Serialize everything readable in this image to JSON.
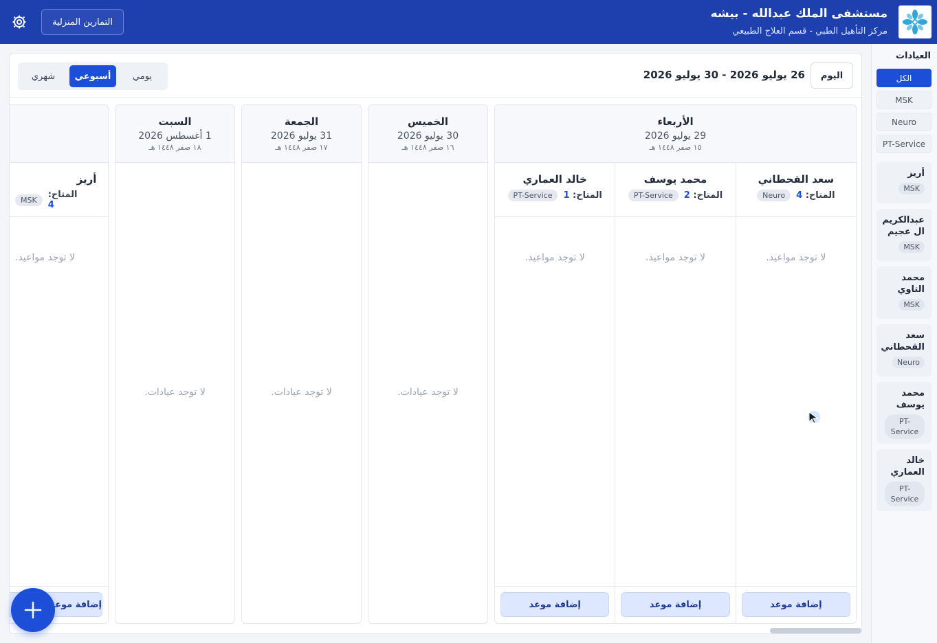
{
  "header": {
    "title": "مستشفى الملك عبدالله - بيشه",
    "subtitle": "مركز التأهيل الطبي - قسم العلاج الطبيعي",
    "home_exercises_label": "التمارين المنزلية",
    "settings_icon": "gear-icon",
    "logo_icon": "star-flower-logo"
  },
  "sidebar": {
    "title": "العيادات",
    "filters": [
      "الكل",
      "MSK",
      "Neuro",
      "PT-Service"
    ],
    "active_filter": "الكل",
    "clinics": [
      {
        "name": "أريز",
        "tag": "MSK"
      },
      {
        "name": "عبدالكريم ال عجيم",
        "tag": "MSK"
      },
      {
        "name": "محمد التاوي",
        "tag": "MSK"
      },
      {
        "name": "سعد القحطاني",
        "tag": "Neuro"
      },
      {
        "name": "محمد يوسف",
        "tag": "PT-Service"
      },
      {
        "name": "خالد العماري",
        "tag": "PT-Service"
      }
    ]
  },
  "toolbar": {
    "today_label": "اليوم",
    "date_range": "26 يوليو 2026 - 30 يوليو 2026",
    "views": [
      "يومي",
      "أسبوعي",
      "شهري"
    ],
    "active_view": "أسبوعي"
  },
  "days": [
    {
      "name": "الأربعاء",
      "greg": "29 يوليو 2026",
      "hijri": "١٥ صفر ١٤٤٨ هـ",
      "doctors": [
        {
          "name": "سعد القحطاني",
          "tag": "Neuro",
          "avail_label": "المتاح:",
          "avail": "4",
          "empty": "لا توجد مواعيد.",
          "add": "إضافة موعد"
        },
        {
          "name": "محمد يوسف",
          "tag": "PT-Service",
          "avail_label": "المتاح:",
          "avail": "2",
          "empty": "لا توجد مواعيد.",
          "add": "إضافة موعد"
        },
        {
          "name": "خالد العماري",
          "tag": "PT-Service",
          "avail_label": "المتاح:",
          "avail": "1",
          "empty": "لا توجد مواعيد.",
          "add": "إضافة موعد"
        }
      ]
    },
    {
      "name": "الخميس",
      "greg": "30 يوليو 2026",
      "hijri": "١٦ صفر ١٤٤٨ هـ",
      "empty": "لا توجد عيادات."
    },
    {
      "name": "الجمعة",
      "greg": "31 يوليو 2026",
      "hijri": "١٧ صفر ١٤٤٨ هـ",
      "empty": "لا توجد عيادات."
    },
    {
      "name": "السبت",
      "greg": "1 أغسطس 2026",
      "hijri": "١٨ صفر ١٤٤٨ هـ",
      "empty": "لا توجد عيادات."
    },
    {
      "doctors": [
        {
          "name": "أريز",
          "tag": "MSK",
          "avail_label": "المتاح:",
          "avail": "4",
          "empty": "لا توجد مواعيد.",
          "add": "إضافة موعد"
        }
      ]
    }
  ],
  "fab_icon": "plus-icon",
  "colors": {
    "primary": "#1e40af",
    "accent": "#1d4ed8"
  }
}
